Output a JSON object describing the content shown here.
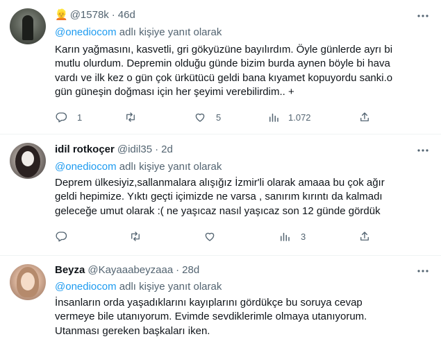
{
  "tweets": [
    {
      "name": "",
      "emoji": "👱",
      "handle": "@1578k",
      "dot": "·",
      "time": "46d",
      "reply_prefix": "@onediocom",
      "reply_suffix": " adlı kişiye yanıt olarak",
      "lines": [
        "Karın yağmasını, kasvetli, gri gökyüzüne bayılırdım. Öyle günlerde ayrı bi",
        "mutlu olurdum. Depremin olduğu günde bizim burda aynen böyle bi hava",
        "vardı ve ilk kez o gün çok ürkütücü geldi bana kıyamet kopuyordu sanki.o",
        "gün güneşin doğması için her şeyimi verebilirdim.. +"
      ],
      "stats": {
        "replies": "1",
        "retweets": "",
        "likes": "5",
        "views": "1.072"
      }
    },
    {
      "name": "idil rotkoçer",
      "handle": "@idil35",
      "dot": "·",
      "time": "2d",
      "reply_prefix": "@onediocom",
      "reply_suffix": " adlı kişiye yanıt olarak",
      "lines": [
        "Deprem ülkesiyiz,sallanmalara alışığız İzmir'li olarak amaaa bu çok ağır",
        "geldi hepimize. Yıktı geçti içimizde ne varsa , sanırım kırıntı da kalmadı",
        "geleceğe umut olarak :( ne yaşıcaz nasıl yaşıcaz son 12 günde gördük"
      ],
      "stats": {
        "replies": "",
        "retweets": "",
        "likes": "",
        "views": "3"
      }
    },
    {
      "name": "Beyza",
      "handle": "@Kayaaabeyzaaa",
      "dot": "·",
      "time": "28d",
      "reply_prefix": "@onediocom",
      "reply_suffix": " adlı kişiye yanıt olarak",
      "lines": [
        "İnsanların orda yaşadıklarını kayıplarını gördükçe bu soruya cevap",
        "vermeye bile utanıyorum. Evimde sevdiklerimle olmaya utanıyorum.",
        "Utanması gereken başkaları iken."
      ]
    }
  ],
  "icons": [
    "more-icon",
    "reply-icon",
    "retweet-icon",
    "like-icon",
    "views-icon",
    "share-icon"
  ],
  "colors": {
    "link": "#1d9bf0",
    "muted": "#536471",
    "text": "#0f1419",
    "divider": "#eff3f4"
  }
}
